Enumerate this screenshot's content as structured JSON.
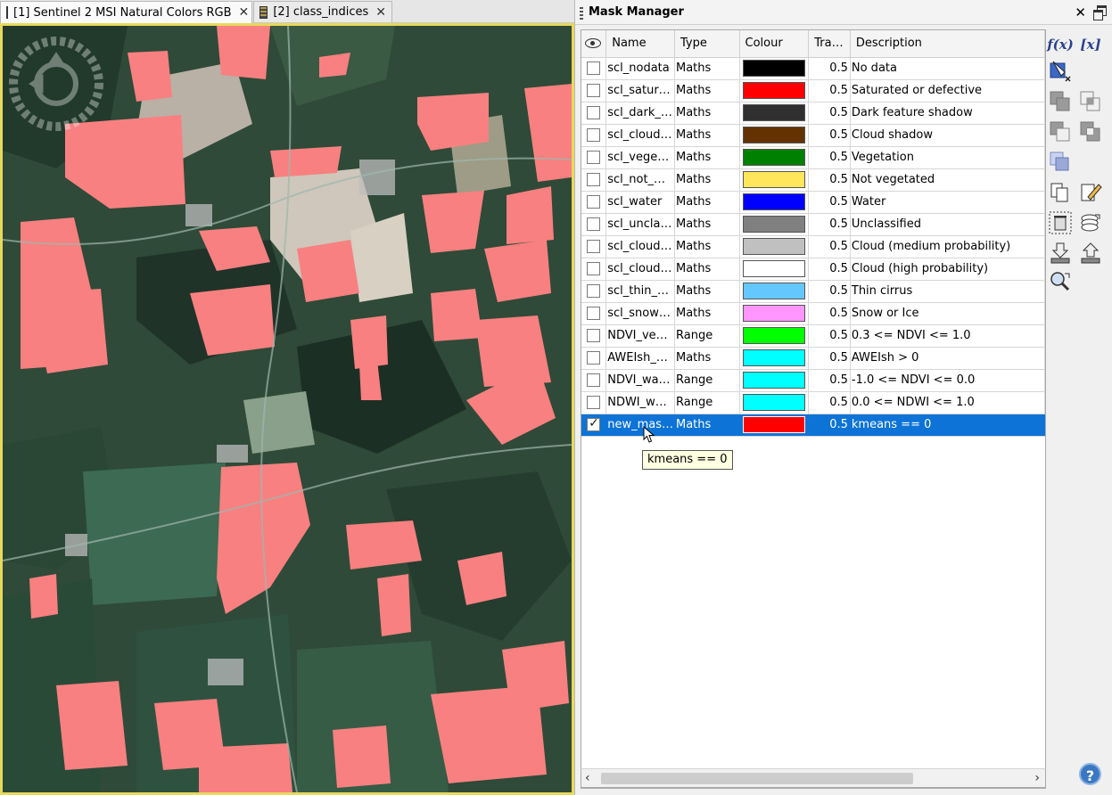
{
  "tabs": [
    {
      "label": "[1] Sentinel 2 MSI Natural Colors RGB",
      "active": true
    },
    {
      "label": "[2] class_indices",
      "active": false
    }
  ],
  "mask_manager": {
    "title": "Mask Manager",
    "columns": [
      "Name",
      "Type",
      "Colour",
      "Tra…",
      "Description"
    ],
    "rows": [
      {
        "visible": false,
        "name": "scl_nodata",
        "type": "Maths",
        "colour": "#000000",
        "transparency": "0.5",
        "description": "No data"
      },
      {
        "visible": false,
        "name": "scl_satur…",
        "type": "Maths",
        "colour": "#ff0000",
        "transparency": "0.5",
        "description": "Saturated or defective"
      },
      {
        "visible": false,
        "name": "scl_dark_…",
        "type": "Maths",
        "colour": "#2f2f2f",
        "transparency": "0.5",
        "description": "Dark feature shadow"
      },
      {
        "visible": false,
        "name": "scl_cloud…",
        "type": "Maths",
        "colour": "#643200",
        "transparency": "0.5",
        "description": "Cloud shadow"
      },
      {
        "visible": false,
        "name": "scl_vege…",
        "type": "Maths",
        "colour": "#008000",
        "transparency": "0.5",
        "description": "Vegetation"
      },
      {
        "visible": false,
        "name": "scl_not_…",
        "type": "Maths",
        "colour": "#ffe65a",
        "transparency": "0.5",
        "description": "Not vegetated"
      },
      {
        "visible": false,
        "name": "scl_water",
        "type": "Maths",
        "colour": "#0000ff",
        "transparency": "0.5",
        "description": "Water"
      },
      {
        "visible": false,
        "name": "scl_uncla…",
        "type": "Maths",
        "colour": "#808080",
        "transparency": "0.5",
        "description": "Unclassified"
      },
      {
        "visible": false,
        "name": "scl_cloud…",
        "type": "Maths",
        "colour": "#c0c0c0",
        "transparency": "0.5",
        "description": "Cloud (medium probability)"
      },
      {
        "visible": false,
        "name": "scl_cloud…",
        "type": "Maths",
        "colour": "#ffffff",
        "transparency": "0.5",
        "description": "Cloud (high probability)"
      },
      {
        "visible": false,
        "name": "scl_thin_…",
        "type": "Maths",
        "colour": "#64c8ff",
        "transparency": "0.5",
        "description": "Thin cirrus"
      },
      {
        "visible": false,
        "name": "scl_snow…",
        "type": "Maths",
        "colour": "#ff96ff",
        "transparency": "0.5",
        "description": "Snow or Ice"
      },
      {
        "visible": false,
        "name": "NDVI_ve…",
        "type": "Range",
        "colour": "#00ff00",
        "transparency": "0.5",
        "description": "0.3 <= NDVI <= 1.0"
      },
      {
        "visible": false,
        "name": "AWEIsh_…",
        "type": "Maths",
        "colour": "#00ffff",
        "transparency": "0.5",
        "description": "AWEIsh > 0"
      },
      {
        "visible": false,
        "name": "NDVI_wa…",
        "type": "Range",
        "colour": "#00ffff",
        "transparency": "0.5",
        "description": "-1.0 <= NDVI <= 0.0"
      },
      {
        "visible": false,
        "name": "NDWI_w…",
        "type": "Range",
        "colour": "#00ffff",
        "transparency": "0.5",
        "description": "0.0 <= NDWI <= 1.0"
      },
      {
        "visible": true,
        "name": "new_mas…",
        "type": "Maths",
        "colour": "#ff0000",
        "transparency": "0.5",
        "description": "kmeans == 0",
        "selected": true
      }
    ],
    "tooltip": "kmeans == 0",
    "toolbar": {
      "fx_label": "f(x)",
      "var_label": "[x]",
      "icons": [
        "magic-wand-icon",
        "union-icon",
        "intersection-icon",
        "difference-icon",
        "xor-icon",
        "complement-icon",
        "copy-icon",
        "edit-icon",
        "delete-icon",
        "transfer-icon",
        "import-icon",
        "export-icon",
        "zoom-to-icon"
      ],
      "help_label": "?"
    }
  }
}
